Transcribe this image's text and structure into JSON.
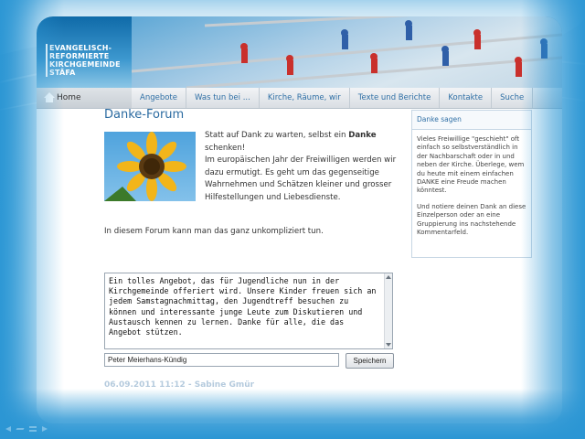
{
  "logo": {
    "lines": [
      "EVANGELISCH-",
      "REFORMIERTE",
      "KIRCHGEMEINDE",
      "STÄFA"
    ]
  },
  "nav": {
    "home_label": "Home",
    "tabs": [
      "Angebote",
      "Was tun bei ...",
      "Kirche, Räume, wir",
      "Texte und Berichte",
      "Kontakte",
      "Suche"
    ]
  },
  "main": {
    "title": "Danke-Forum",
    "intro_1": "Statt auf Dank zu warten, selbst ein ",
    "intro_bold": "Danke",
    "intro_2": " schenken!",
    "intro_3": "Im europäischen Jahr der Freiwilligen werden wir dazu ermutigt. Es geht um das gegenseitige Wahrnehmen und Schätzen kleiner und grosser Hilfestellungen und Liebesdienste.",
    "easy": "In diesem Forum kann man das ganz unkompliziert tun."
  },
  "sidebar": {
    "heading": "Danke sagen",
    "text_1": "Vieles Freiwillige \"geschieht\" oft einfach so selbstverständlich in der Nachbarschaft oder in und neben der Kirche. Überlege, wem du heute mit einem einfachen DANKE eine Freude machen könntest.",
    "text_2": "Und notiere deinen Dank an diese Einzelperson oder an eine Gruppierung ins nachstehende Kommentarfeld."
  },
  "form": {
    "message": "Ein tolles Angebot, das für Jugendliche nun in der Kirchgemeinde offeriert wird. Unsere Kinder freuen sich an jedem Samstagnachmittag, den Jugendtreff besuchen zu können und interessante junge Leute zum Diskutieren und Austausch kennen zu lernen. Danke für alle, die das Angebot stützen.",
    "name_value": "Peter Meierhans-Kündig",
    "save_label": "Speichern"
  },
  "entry": {
    "header": "06.09.2011 11:12 - Sabine Gmür"
  },
  "colors": {
    "accent": "#2a6aa0",
    "page_bg": "#2b96d4"
  }
}
